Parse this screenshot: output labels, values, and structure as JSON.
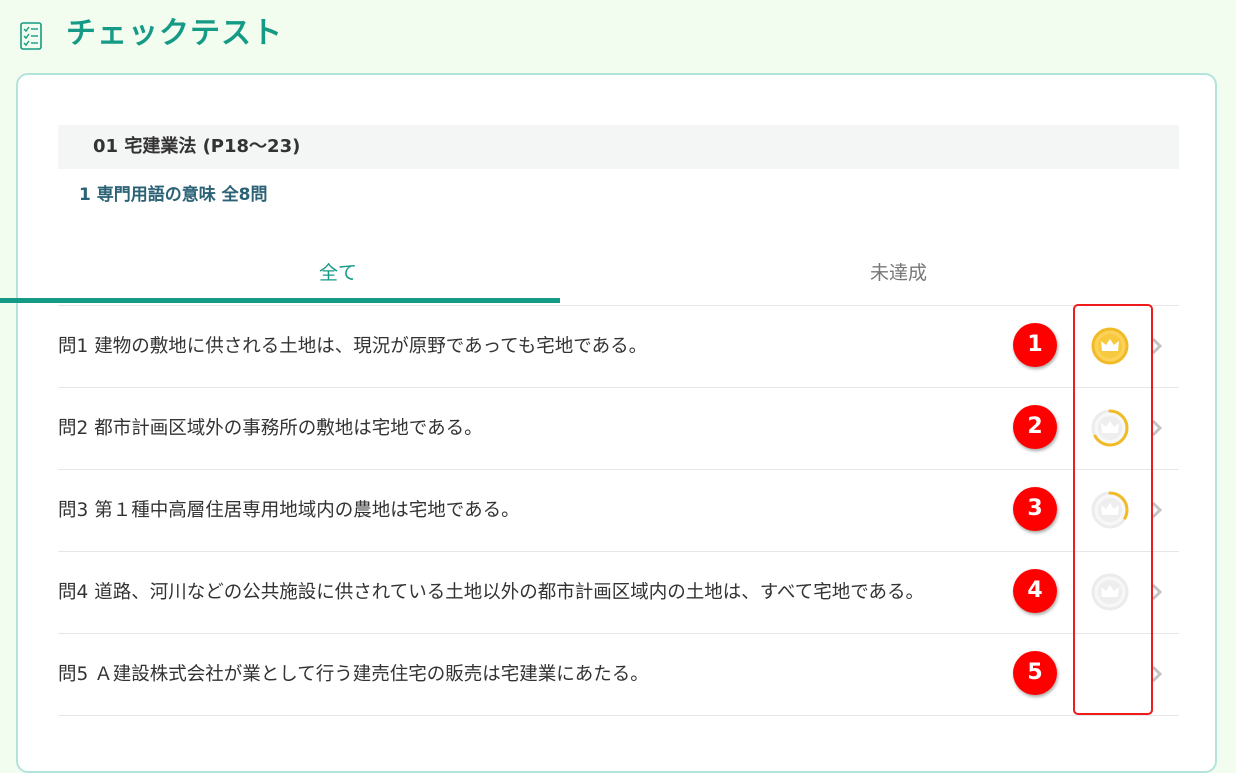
{
  "header": {
    "title": "チェックテスト",
    "icon": "checklist-icon"
  },
  "section": {
    "title": "01 宅建業法 (P18〜23)"
  },
  "subsection": {
    "title": "1 専門用語の意味 全8問"
  },
  "tabs": [
    {
      "label": "全て",
      "active": true
    },
    {
      "label": "未達成",
      "active": false
    }
  ],
  "questions": [
    {
      "num": "問1",
      "text": "建物の敷地に供される土地は、現況が原野であっても宅地である。",
      "badge": "1",
      "medal": "gold",
      "progress": 1.0
    },
    {
      "num": "問2",
      "text": "都市計画区域外の事務所の敷地は宅地である。",
      "badge": "2",
      "medal": "progress",
      "progress": 0.67
    },
    {
      "num": "問3",
      "text": "第１種中高層住居専用地域内の農地は宅地である。",
      "badge": "3",
      "medal": "progress",
      "progress": 0.33
    },
    {
      "num": "問4",
      "text": "道路、河川などの公共施設に供されている土地以外の都市計画区域内の土地は、すべて宅地である。",
      "badge": "4",
      "medal": "empty",
      "progress": 0
    },
    {
      "num": "問5",
      "text": "Ａ建設株式会社が業として行う建売住宅の販売は宅建業にあたる。",
      "badge": "5",
      "medal": "none",
      "progress": 0
    }
  ],
  "colors": {
    "accent": "#159a86",
    "gold": "#f1bb27",
    "badge": "#ff0000",
    "highlight": "#ee1c1c"
  }
}
